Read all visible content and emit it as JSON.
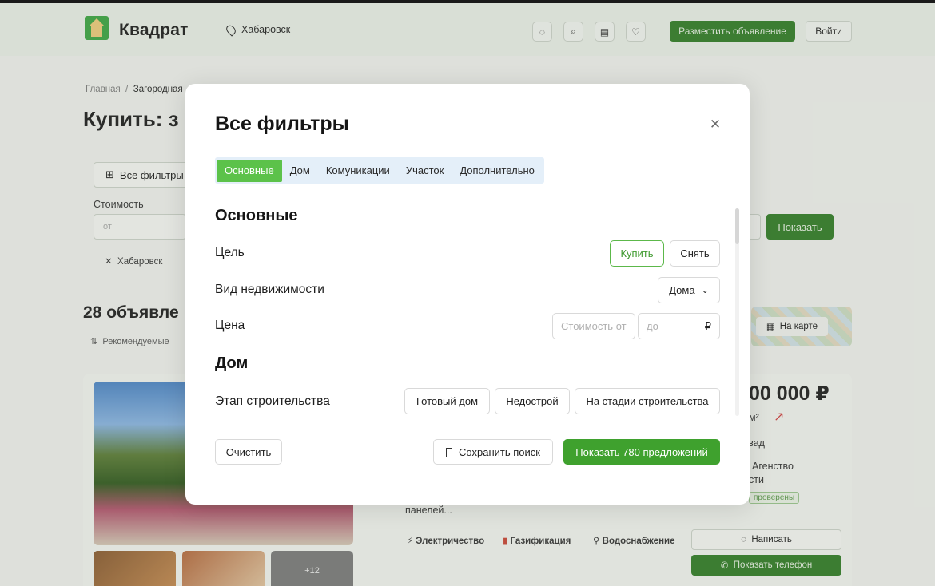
{
  "header": {
    "logo_text": "Квадрат",
    "city": "Хабаровск",
    "icons": [
      "chat-icon",
      "search-icon",
      "document-icon",
      "heart-icon"
    ],
    "post_button": "Разместить объявление",
    "login_button": "Войти"
  },
  "background": {
    "breadcrumb_home": "Главная",
    "breadcrumb_sep": "/",
    "breadcrumb_current": "Загородная",
    "page_title": "Купить: з",
    "all_filters_button": "Все фильтры",
    "cost_label": "Стоимость",
    "cost_from_placeholder": "от",
    "city_tag": "Хабаровск",
    "show_button": "Показать",
    "results_count": "28 объявле",
    "sort_label": "Рекомендуемые",
    "map_button": "На карте",
    "listing": {
      "price": "00 000 ₽",
      "area": "м²",
      "date": "зад",
      "agency_line1": "Агенство",
      "agency_line2": "сти",
      "verified": "проверены",
      "snippet": "панелей...",
      "features": [
        "Электричество",
        "Газификация",
        "Водоснабжение"
      ],
      "thumb_more": "+12",
      "write_button": "Написать",
      "phone_button": "Показать телефон"
    }
  },
  "modal": {
    "title": "Все фильтры",
    "tabs": [
      {
        "label": "Основные",
        "active": true
      },
      {
        "label": "Дом",
        "active": false
      },
      {
        "label": "Комуникации",
        "active": false
      },
      {
        "label": "Участок",
        "active": false
      },
      {
        "label": "Дополнительно",
        "active": false
      }
    ],
    "sections": {
      "main": {
        "heading": "Основные",
        "goal_label": "Цель",
        "goal_options": [
          {
            "label": "Купить",
            "selected": true
          },
          {
            "label": "Снять",
            "selected": false
          }
        ],
        "property_type_label": "Вид недвижимости",
        "property_type_value": "Дома",
        "price_label": "Цена",
        "price_from_placeholder": "Стоимость от",
        "price_to_placeholder": "до",
        "currency": "₽"
      },
      "house": {
        "heading": "Дом",
        "stage_label": "Этап строительства",
        "stage_options": [
          "Готовый дом",
          "Недострой",
          "На стадии строительства"
        ]
      }
    },
    "footer": {
      "clear_button": "Очистить",
      "save_button": "Сохранить поиск",
      "show_button": "Показать 780 предложений"
    }
  },
  "colors": {
    "brand_green": "#3fa12e",
    "active_tab_green": "#5cc24a",
    "tabs_bg": "#e4eff9"
  }
}
